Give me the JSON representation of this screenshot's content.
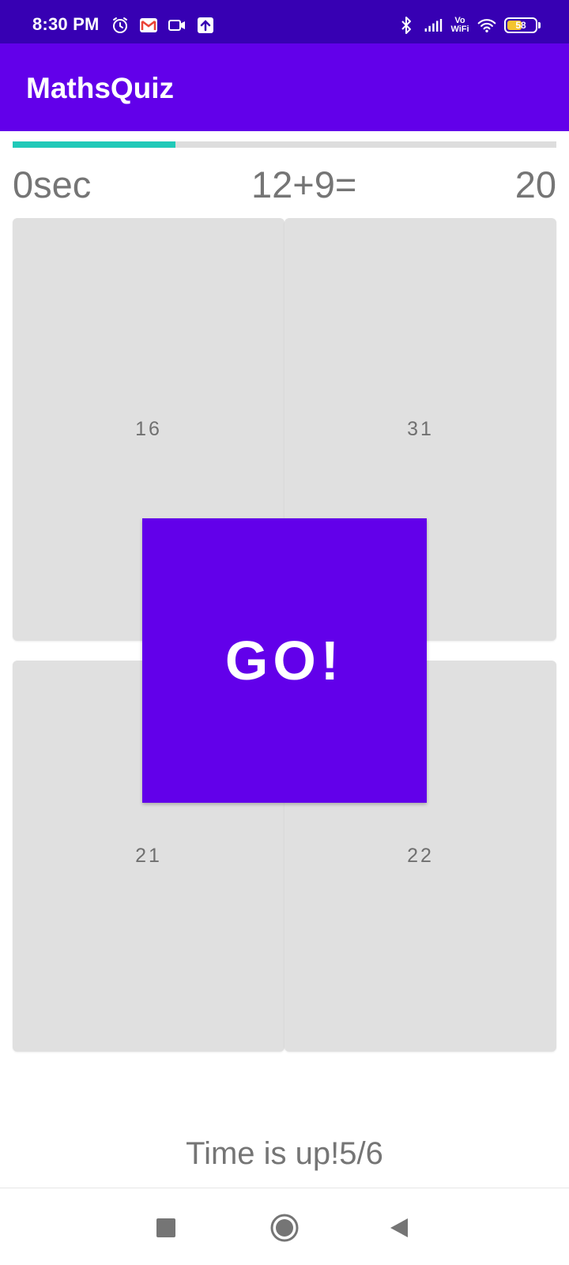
{
  "status_bar": {
    "time": "8:30 PM",
    "left_icons": [
      "alarm-icon",
      "gmail-icon",
      "video-camera-icon",
      "upload-icon"
    ],
    "right_icons": [
      "bluetooth-icon",
      "signal-icon",
      "vowifi-icon",
      "wifi-icon",
      "battery-icon"
    ],
    "vowifi_top": "Vo",
    "vowifi_bottom": "WiFi",
    "battery_level": "58",
    "battery_fraction": 0.58
  },
  "app_bar": {
    "title": "MathsQuiz"
  },
  "colors": {
    "status_bar": "#3700b3",
    "primary": "#6200ea",
    "progress": "#20c9b8",
    "button_gray": "#e0e0e0",
    "text_gray": "#757575"
  },
  "quiz": {
    "progress_fraction": 0.3,
    "timer": "0sec",
    "question": "12+9=",
    "score": "20",
    "answers": [
      "16",
      "31",
      "21",
      "22"
    ],
    "go_label": "GO!",
    "result": "Time is up!5/6"
  },
  "nav_bar": {
    "buttons": [
      "recent-apps-icon",
      "home-icon",
      "back-icon"
    ]
  }
}
